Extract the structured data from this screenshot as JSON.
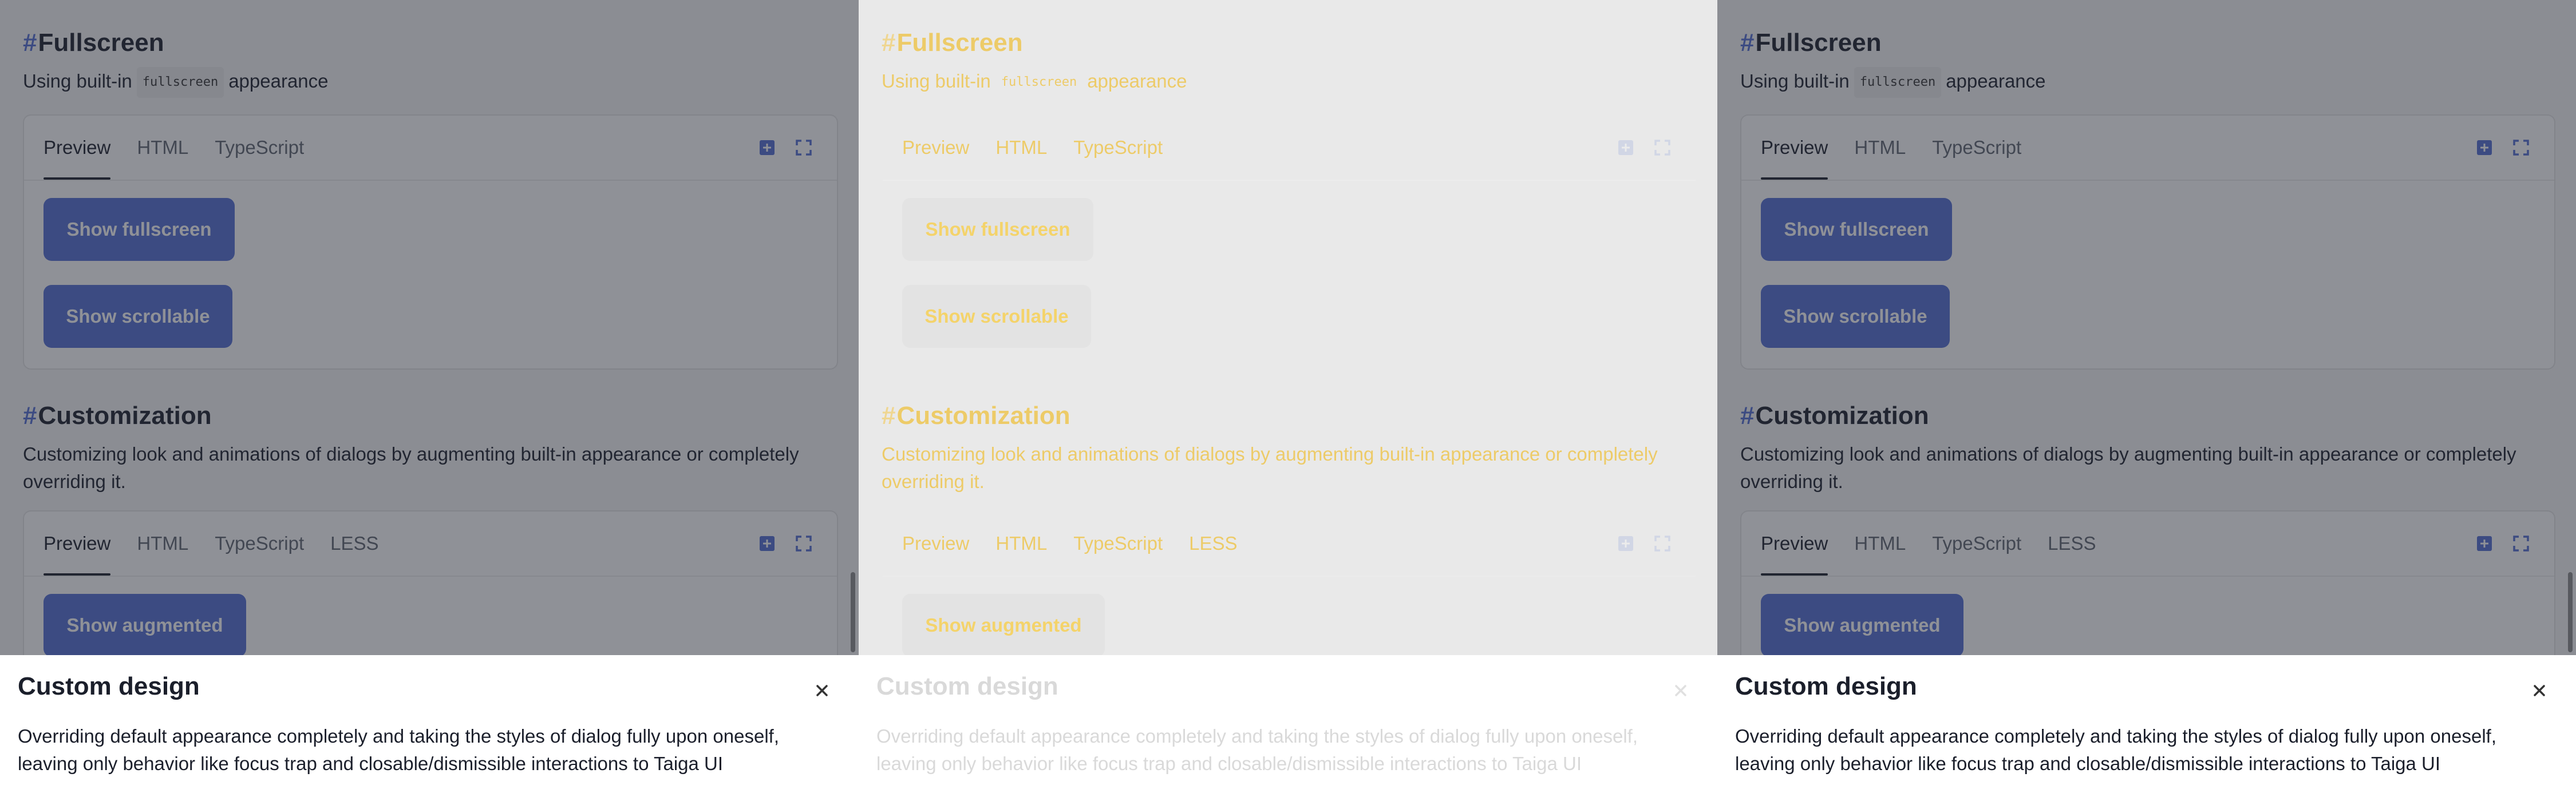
{
  "fullscreen": {
    "hash": "#",
    "title": "Fullscreen",
    "desc_before": "Using built-in",
    "desc_code": "fullscreen",
    "desc_after": "appearance",
    "tabs": [
      "Preview",
      "HTML",
      "TypeScript"
    ],
    "buttons": [
      "Show fullscreen",
      "Show scrollable"
    ]
  },
  "customization": {
    "hash": "#",
    "title": "Customization",
    "desc": "Customizing look and animations of dialogs by augmenting built-in appearance or completely overriding it.",
    "tabs": [
      "Preview",
      "HTML",
      "TypeScript",
      "LESS"
    ],
    "button": "Show augmented"
  },
  "dialog": {
    "title": "Custom design",
    "text": "Overriding default appearance completely and taking the styles of dialog fully upon oneself, leaving only behavior like focus trap and closable/dismissible interactions to Taiga UI"
  },
  "icons": {
    "expand": "expand-plus-icon",
    "fullscreen": "fullscreen-icon",
    "close": "close-icon"
  },
  "colors": {
    "accent": "#526ed3",
    "text": "#1b1f2b"
  }
}
